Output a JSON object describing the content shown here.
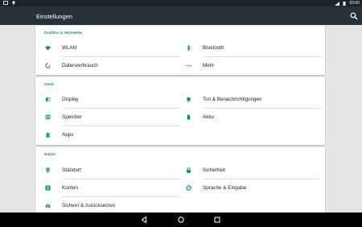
{
  "statusbar": {
    "time": "02:00"
  },
  "appbar": {
    "title": "Einstellungen"
  },
  "sections": [
    {
      "header": "Drahtlos & Netzwerke",
      "items": [
        {
          "label": "WLAN",
          "icon": "wifi-icon"
        },
        {
          "label": "Bluetooth",
          "icon": "bluetooth-icon"
        },
        {
          "label": "Datenverbrauch",
          "icon": "data-usage-icon"
        },
        {
          "label": "Mehr",
          "icon": "more-icon"
        }
      ]
    },
    {
      "header": "Gerät",
      "items": [
        {
          "label": "Display",
          "icon": "brightness-icon"
        },
        {
          "label": "Ton & Benachrichtigungen",
          "icon": "bell-icon"
        },
        {
          "label": "Speicher",
          "icon": "storage-icon"
        },
        {
          "label": "Akku",
          "icon": "battery-icon"
        },
        {
          "label": "Apps",
          "icon": "android-icon"
        }
      ]
    },
    {
      "header": "Nutzer",
      "items": [
        {
          "label": "Standort",
          "icon": "location-icon"
        },
        {
          "label": "Sicherheit",
          "icon": "lock-icon"
        },
        {
          "label": "Konten",
          "icon": "account-icon"
        },
        {
          "label": "Sprache & Eingabe",
          "icon": "globe-icon"
        },
        {
          "label": "Sichern & zurücksetzen",
          "icon": "cloud-upload-icon"
        }
      ]
    }
  ],
  "colors": {
    "appbar": "#263238",
    "statusbar": "#1b2326",
    "accent": "#009688",
    "icon": "#009688",
    "background": "#e6e6e6"
  }
}
